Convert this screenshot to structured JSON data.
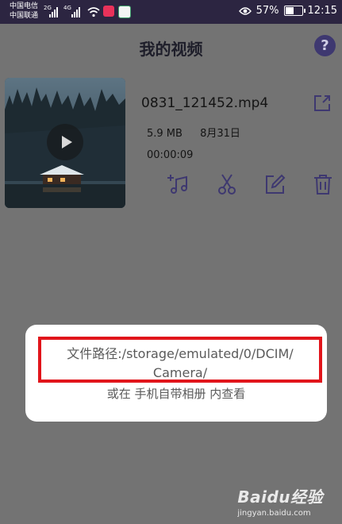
{
  "status_bar": {
    "carrier_1": "中国电信",
    "carrier_2": "中国联通",
    "network_1": "2G",
    "network_2": "4G",
    "battery_percent": "57%",
    "battery_level": 0.57,
    "time": "12:15",
    "icons": [
      "signal-icon",
      "wifi-icon",
      "app-icon",
      "eye-icon",
      "battery-icon"
    ]
  },
  "header": {
    "title": "我的视频",
    "help_label": "?"
  },
  "video": {
    "filename": "0831_121452.mp4",
    "size": "5.9 MB",
    "date": "8月31日",
    "duration": "00:00:09",
    "actions": [
      "add-music-icon",
      "cut-icon",
      "edit-icon",
      "delete-icon"
    ]
  },
  "dialog": {
    "path_line_1": "文件路径:/storage/emulated/0/DCIM/",
    "path_line_2": "Camera/",
    "hint": "或在 手机自带相册 内查看"
  },
  "watermark": {
    "brand": "Baidu经验",
    "url": "jingyan.baidu.com"
  },
  "colors": {
    "overlay_bg": "#737373",
    "statusbar_bg": "#2c2541",
    "accent": "#3e3870",
    "highlight_border": "#e1151b"
  }
}
